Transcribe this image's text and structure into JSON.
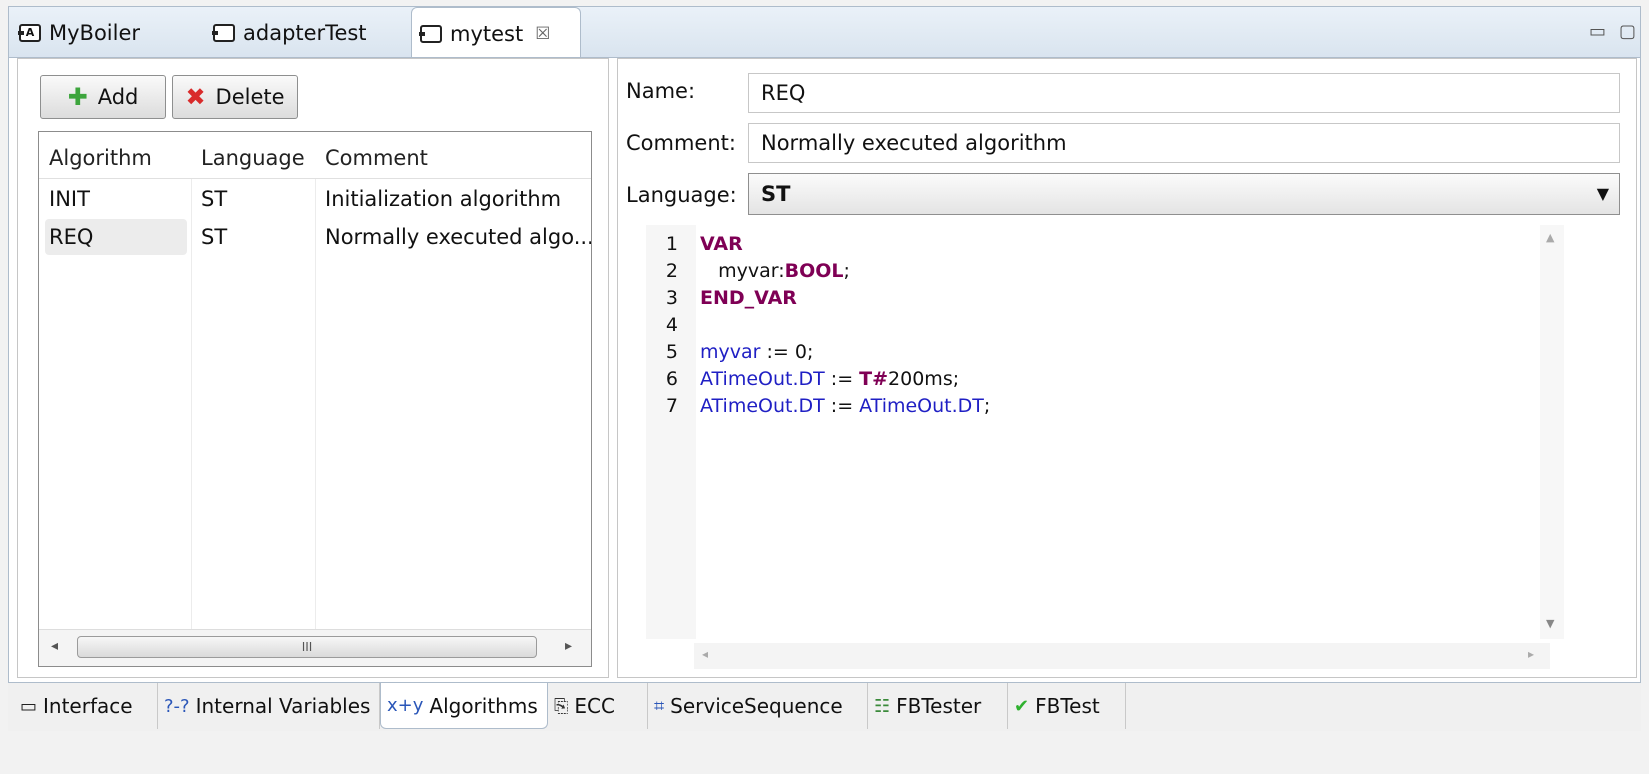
{
  "editor_tabs": [
    {
      "label": "MyBoiler",
      "icon": "adapter-icon"
    },
    {
      "label": "adapterTest",
      "icon": "function-block-icon"
    },
    {
      "label": "mytest",
      "icon": "function-block-icon",
      "close": "☒",
      "active": true
    }
  ],
  "window_controls": {
    "minimize": "▭",
    "maximize": "▢"
  },
  "toolbar": {
    "add_label": "Add",
    "delete_label": "Delete"
  },
  "algorithm_table": {
    "columns": [
      "Algorithm",
      "Language",
      "Comment"
    ],
    "rows": [
      {
        "algorithm": "INIT",
        "language": "ST",
        "comment": "Initialization algorithm"
      },
      {
        "algorithm": "REQ",
        "language": "ST",
        "comment": "Normally executed algo..."
      }
    ],
    "selected_index": 1,
    "scroll_thumb": "III"
  },
  "details": {
    "name_label": "Name:",
    "name_value": "REQ",
    "comment_label": "Comment:",
    "comment_value": "Normally executed algorithm",
    "language_label": "Language:",
    "language_value": "ST"
  },
  "code_lines": [
    {
      "n": "1",
      "parts": [
        {
          "t": "VAR",
          "c": "kw"
        }
      ]
    },
    {
      "n": "2",
      "parts": [
        {
          "t": "   myvar:",
          "c": "plain"
        },
        {
          "t": "BOOL",
          "c": "kw"
        },
        {
          "t": ";",
          "c": "plain"
        }
      ]
    },
    {
      "n": "3",
      "parts": [
        {
          "t": "END_VAR",
          "c": "kw"
        }
      ]
    },
    {
      "n": "4",
      "parts": []
    },
    {
      "n": "5",
      "parts": [
        {
          "t": "myvar",
          "c": "id"
        },
        {
          "t": " := 0;",
          "c": "plain"
        }
      ]
    },
    {
      "n": "6",
      "parts": [
        {
          "t": "ATimeOut.DT",
          "c": "id"
        },
        {
          "t": " := ",
          "c": "plain"
        },
        {
          "t": "T#",
          "c": "kw"
        },
        {
          "t": "200ms;",
          "c": "plain"
        }
      ]
    },
    {
      "n": "7",
      "parts": [
        {
          "t": "ATimeOut.DT",
          "c": "id"
        },
        {
          "t": " := ",
          "c": "plain"
        },
        {
          "t": "ATimeOut.DT",
          "c": "id"
        },
        {
          "t": ";",
          "c": "plain"
        }
      ]
    }
  ],
  "bottom_tabs": [
    {
      "label": "Interface",
      "icon": "▭"
    },
    {
      "label": "Internal Variables",
      "icon": "?-?"
    },
    {
      "label": "Algorithms",
      "icon": "x+y",
      "active": true
    },
    {
      "label": "ECC",
      "icon": "⎘"
    },
    {
      "label": "ServiceSequence",
      "icon": "⌗"
    },
    {
      "label": "FBTester",
      "icon": "☷"
    },
    {
      "label": "FBTest",
      "icon": "✔"
    }
  ],
  "colors": {
    "keyword": "#7f0055",
    "identifier": "#1f1fc4",
    "tab_border": "#aebccb"
  }
}
